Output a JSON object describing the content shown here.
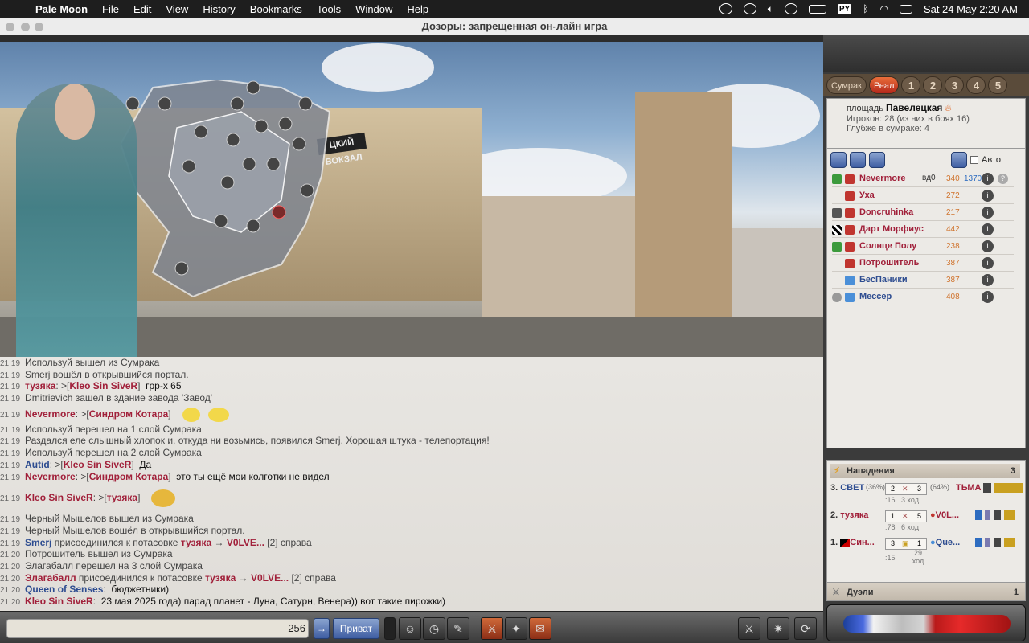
{
  "menubar": {
    "app": "Pale Moon",
    "items": [
      "File",
      "Edit",
      "View",
      "History",
      "Bookmarks",
      "Tools",
      "Window",
      "Help"
    ],
    "input_source": "PY",
    "clock": "Sat 24 May  2:20 AM"
  },
  "window": {
    "title": "Дозоры: запрещенная он-лайн игра"
  },
  "scene": {
    "sign_text": "ЦКИЙ ВОКЗАЛ"
  },
  "chat": {
    "lines": [
      {
        "time": "21:19",
        "text": "Используй вышел из Сумрака"
      },
      {
        "time": "21:19",
        "text": "Smerj вошёл в открывшийся портал."
      },
      {
        "time": "21:19",
        "from": "тузяка",
        "to": "Kleo Sin SiveR",
        "msg": "грр-х 65"
      },
      {
        "time": "21:19",
        "text": "Dmitrievich зашел в здание завода 'Завод'"
      },
      {
        "time": "21:19",
        "from": "Nevermore",
        "to": "Синдром Котара",
        "msg": ""
      },
      {
        "time": "21:19",
        "text": "Используй перешел на 1 слой Сумрака"
      },
      {
        "time": "21:19",
        "text": "Раздался еле слышный хлопок и, откуда ни возьмись, появился Smerj. Хорошая штука - телепортация!"
      },
      {
        "time": "21:19",
        "text": "Используй перешел на 2 слой Сумрака"
      },
      {
        "time": "21:19",
        "from": "Autid",
        "to": "Kleo Sin SiveR",
        "msg": "Да",
        "blue": true
      },
      {
        "time": "21:19",
        "from": "Nevermore",
        "to": "Синдром Котара",
        "msg": "это ты ещё мои колготки не видел"
      },
      {
        "time": "21:19",
        "from": "Kleo Sin SiveR",
        "to": "тузяка",
        "msg": ""
      },
      {
        "time": "21:19",
        "text": "Черный Мышелов вышел из Сумрака"
      },
      {
        "time": "21:19",
        "text": "Черный Мышелов вошёл в открывшийся портал."
      },
      {
        "time": "21:19",
        "pre": "Smerj",
        "mid": " присоединился к потасовке ",
        "a": "тузяка",
        "arrow": " → ",
        "b": "V0LVE...",
        "tail": " [2] справа"
      },
      {
        "time": "21:20",
        "text": "Потрошитель вышел из Сумрака"
      },
      {
        "time": "21:20",
        "text": "Элагабалл перешел на 3 слой Сумрака"
      },
      {
        "time": "21:20",
        "pre": "Элагабалл",
        "mid": " присоединился к потасовке ",
        "a": "тузяка",
        "arrow": " → ",
        "b": "V0LVE...",
        "tail": " [2] справа"
      },
      {
        "time": "21:20",
        "from": "Queen of Senses",
        "msg": "бюджетники)",
        "blue": true
      },
      {
        "time": "21:20",
        "from": "Kleo Sin SiveR",
        "msg": "23 мая 2025 года) парад планет - Луна, Сатурн, Венера)) вот такие пирожки)"
      }
    ]
  },
  "input": {
    "counter": "256",
    "private_label": "Приват"
  },
  "right": {
    "tabs": [
      "Сумрак",
      "Реал",
      "1",
      "2",
      "3",
      "4",
      "5"
    ],
    "location": {
      "prefix": "площадь ",
      "name": "Павелецкая",
      "players": "Игроков: 28 (из них в боях 16)",
      "depth": "Глубже в сумраке: 4"
    },
    "auto_label": "Авто",
    "players": [
      {
        "name": "Nevermore",
        "level": "вд0",
        "hp": "340",
        "mp": "1370"
      },
      {
        "name": "Уха",
        "hp": "272"
      },
      {
        "name": "Doncruhinka",
        "hp": "217"
      },
      {
        "name": "Дарт Морфиус",
        "hp": "442"
      },
      {
        "name": "Солнце Полу",
        "hp": "238"
      },
      {
        "name": "Потрошитель",
        "hp": "387"
      },
      {
        "name": "БесПаники",
        "hp": "387",
        "blue": true
      },
      {
        "name": "Мессер",
        "hp": "408",
        "blue": true
      }
    ],
    "battles": {
      "title": "Нападения",
      "count": "3",
      "rows": [
        {
          "idx": "3.",
          "left": "СВЕТ",
          "lpct": "(36%)",
          "ls": "2",
          "rs": "3",
          "rpct": "(64%)",
          "right": "ТЬМА",
          "time": ":16",
          "turn": "3 ход"
        },
        {
          "idx": "2.",
          "left": "тузяка",
          "ls": "1",
          "rs": "5",
          "right": "V0L...",
          "time": ":78",
          "turn": "6 ход"
        },
        {
          "idx": "1.",
          "left": "Син...",
          "ls": "3",
          "rs": "1",
          "right": "Que...",
          "time": ":15",
          "turn": "29",
          "turn2": "ход"
        }
      ]
    },
    "duels": {
      "title": "Дуэли",
      "count": "1"
    }
  },
  "colors": {
    "red_name": "#a1203a",
    "blue_name": "#2d4c90",
    "accent": "#d0742e"
  }
}
